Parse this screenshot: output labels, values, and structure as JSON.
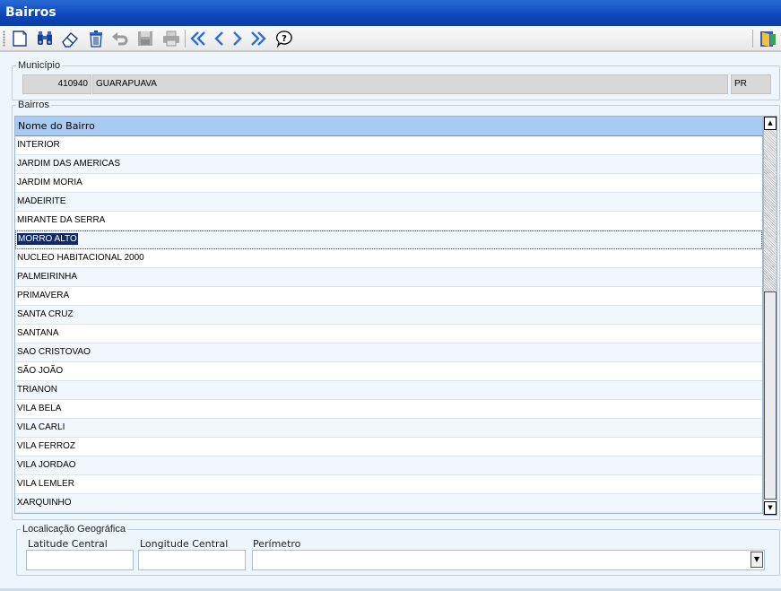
{
  "window": {
    "title": "Bairros"
  },
  "toolbar": {
    "buttons": [
      {
        "icon": "new-document-icon"
      },
      {
        "icon": "binoculars-icon"
      },
      {
        "icon": "eraser-icon"
      },
      {
        "icon": "trash-icon"
      },
      {
        "icon": "undo-icon"
      },
      {
        "icon": "save-disk-icon"
      },
      {
        "icon": "printer-icon"
      },
      {
        "icon": "first-record-icon"
      },
      {
        "icon": "previous-record-icon"
      },
      {
        "icon": "next-record-icon"
      },
      {
        "icon": "last-record-icon"
      },
      {
        "icon": "help-icon"
      },
      {
        "icon": "exit-door-icon"
      }
    ],
    "accent": "#1f5fd0"
  },
  "municipio": {
    "legend": "Município",
    "code": "410940",
    "name": "GUARAPUAVA",
    "uf": "PR"
  },
  "bairros": {
    "legend": "Bairros",
    "column_header": "Nome do Bairro",
    "header_color": "#a9cbf1",
    "selected_index": 5,
    "rows": [
      "INTERIOR",
      "JARDIM DAS AMERICAS",
      "JARDIM MORIA",
      "MADEIRITE",
      "MIRANTE DA SERRA",
      "MORRO ALTO",
      "NUCLEO HABITACIONAL 2000",
      "PALMEIRINHA",
      "PRIMAVERA",
      "SANTA CRUZ",
      "SANTANA",
      "SAO CRISTOVAO",
      "SÃO JOÃO",
      "TRIANON",
      "VILA BELA",
      "VILA CARLI",
      "VILA FERROZ",
      "VILA JORDAO",
      "VILA LEMLER",
      "XARQUINHO"
    ]
  },
  "geo": {
    "legend": "Localicação Geográfica",
    "latitude_label": "Latitude Central",
    "longitude_label": "Longitude Central",
    "perimetro_label": "Perímetro",
    "latitude_value": "",
    "longitude_value": "",
    "perimetro_value": ""
  }
}
